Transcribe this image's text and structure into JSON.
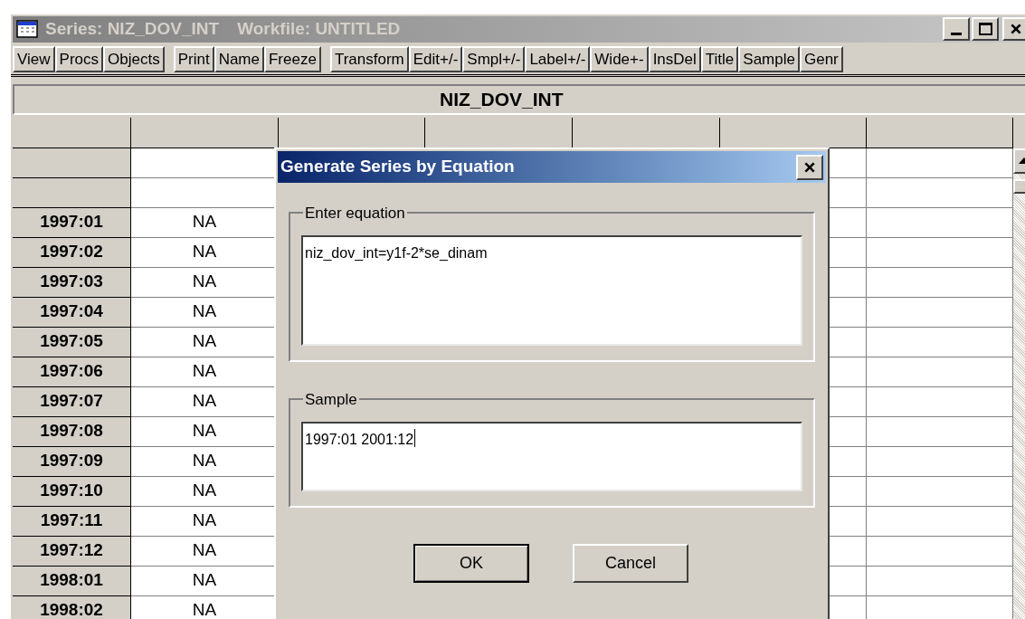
{
  "window": {
    "title": [
      "Series: NIZ_DOV_INT",
      "Workfile: UNTITLED"
    ],
    "active": false
  },
  "toolbar": [
    [
      "View",
      "Procs",
      "Objects"
    ],
    [
      "Print",
      "Name",
      "Freeze"
    ],
    [
      "Transform",
      "Edit+/-",
      "Smpl+/-",
      "Label+/-",
      "Wide+-",
      "InsDel",
      "Title",
      "Sample",
      "Genr"
    ]
  ],
  "series_header": "NIZ_DOV_INT",
  "table": {
    "rows": [
      {
        "label": "1997:01",
        "column_2": "NA"
      },
      {
        "label": "1997:02",
        "column_2": "NA"
      },
      {
        "label": "1997:03",
        "column_2": "NA"
      },
      {
        "label": "1997:04",
        "column_2": "NA"
      },
      {
        "label": "1997:05",
        "column_2": "NA"
      },
      {
        "label": "1997:06",
        "column_2": "NA"
      },
      {
        "label": "1997:07",
        "column_2": "NA"
      },
      {
        "label": "1997:08",
        "column_2": "NA"
      },
      {
        "label": "1997:09",
        "column_2": "NA"
      },
      {
        "label": "1997:10",
        "column_2": "NA"
      },
      {
        "label": "1997:11",
        "column_2": "NA"
      },
      {
        "label": "1997:12",
        "column_2": "NA"
      },
      {
        "label": "1998:01",
        "column_2": "NA"
      },
      {
        "label": "1998:02",
        "column_2": "NA"
      }
    ]
  },
  "dialog": {
    "title": "Generate Series by Equation",
    "active": true,
    "groups": [
      {
        "label": "Enter equation",
        "value": "niz_dov_int=y1f-2*se_dinam",
        "focused": false
      },
      {
        "label": "Sample",
        "value": "1997:01 2001:12",
        "focused": true
      }
    ],
    "buttons": [
      {
        "label": "OK",
        "default": true
      },
      {
        "label": "Cancel",
        "default": false
      }
    ]
  }
}
